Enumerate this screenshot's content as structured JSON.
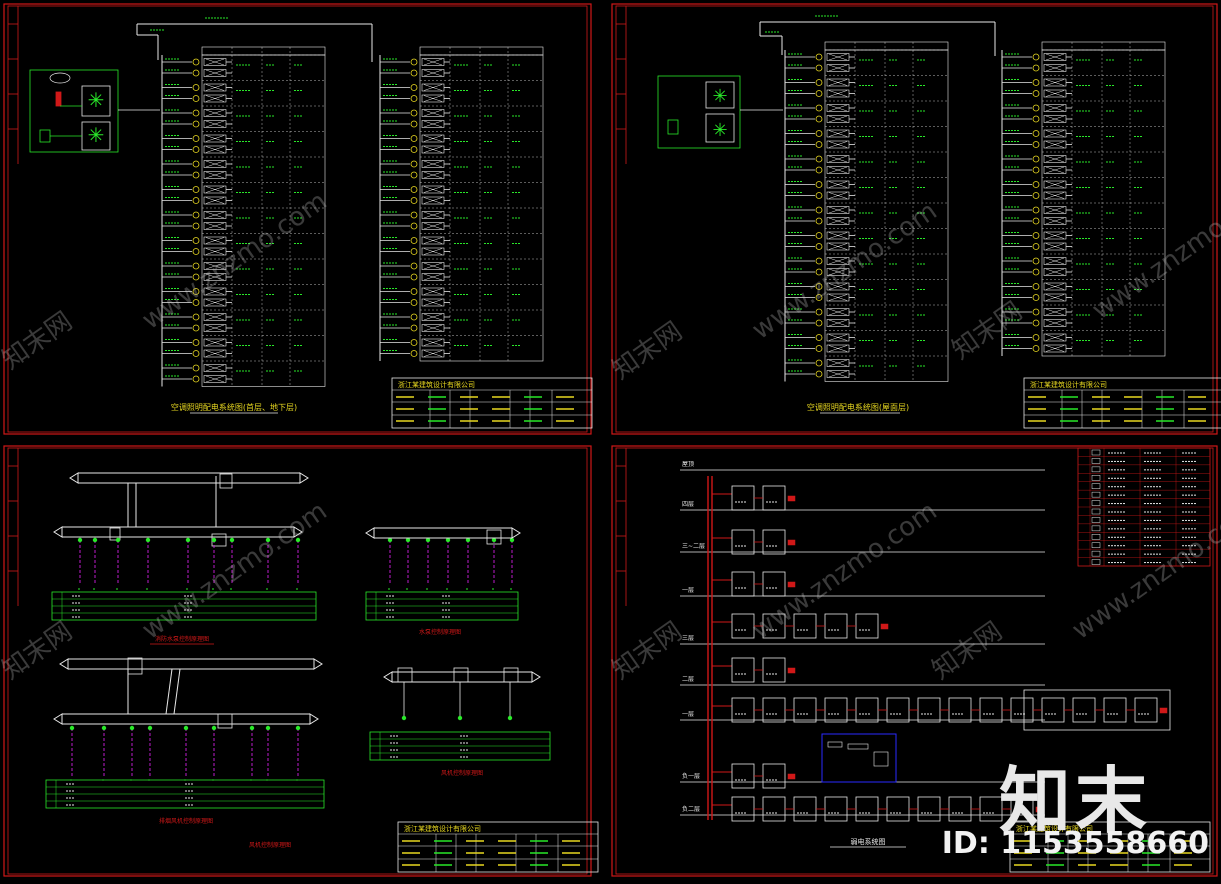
{
  "colors": {
    "background": "#000000",
    "frame": "#d01818",
    "wire": "#e8e8e8",
    "text_green": "#29e829",
    "text_yellow": "#e8d820",
    "magenta": "#d020e0",
    "cyan": "#20d8d8",
    "blue": "#2a2aff"
  },
  "sheets": {
    "top_left": {
      "caption": "空调照明配电系统图(首层、地下层)",
      "table_rows": 12,
      "company": "浙江某建筑设计有限公司"
    },
    "top_right": {
      "caption": "空调照明配电系统图(屋面层)",
      "table_rows": 12,
      "company": "浙江某建筑设计有限公司"
    },
    "bottom_left": {
      "caption_upper": "消防水泵控制原理图",
      "caption_lower": "排烟风机控制原理图",
      "caption_right_upper": "水泵控制原理图",
      "caption_right_lower": "风机控制原理图",
      "company": "浙江某建筑设计有限公司"
    },
    "bottom_right": {
      "floors": [
        "屋顶",
        "四层",
        "三~二层",
        "一层",
        "三层",
        "二层",
        "一层",
        "负一层",
        "负二层"
      ],
      "caption": "弱电系统图",
      "legend_rows": 14,
      "company": "浙江某建筑设计有限公司"
    }
  },
  "watermark": {
    "logo": "知末",
    "id_text": "ID: 1153558660",
    "diag_text": "www.znzmo.com",
    "brand": "知末网"
  }
}
